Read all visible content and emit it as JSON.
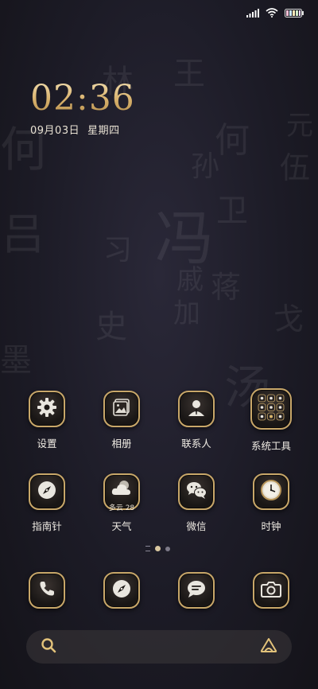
{
  "clock": {
    "time": "02:36",
    "date": "09月03日",
    "weekday": "星期四"
  },
  "apps_row1": [
    {
      "label": "设置",
      "icon": "gear-icon"
    },
    {
      "label": "相册",
      "icon": "gallery-icon"
    },
    {
      "label": "联系人",
      "icon": "contacts-icon"
    },
    {
      "label": "系统工具",
      "icon": "folder-grid-icon"
    }
  ],
  "apps_row2": [
    {
      "label": "指南针",
      "icon": "compass-icon"
    },
    {
      "label": "天气",
      "icon": "weather-icon",
      "sub": "多云 28"
    },
    {
      "label": "微信",
      "icon": "wechat-icon"
    },
    {
      "label": "时钟",
      "icon": "clock-icon"
    }
  ],
  "dock": [
    {
      "icon": "phone-icon"
    },
    {
      "icon": "browser-icon"
    },
    {
      "icon": "messages-icon"
    },
    {
      "icon": "camera-icon"
    }
  ],
  "colors": {
    "gold": "#c8a769",
    "background": "#1c1b26"
  }
}
